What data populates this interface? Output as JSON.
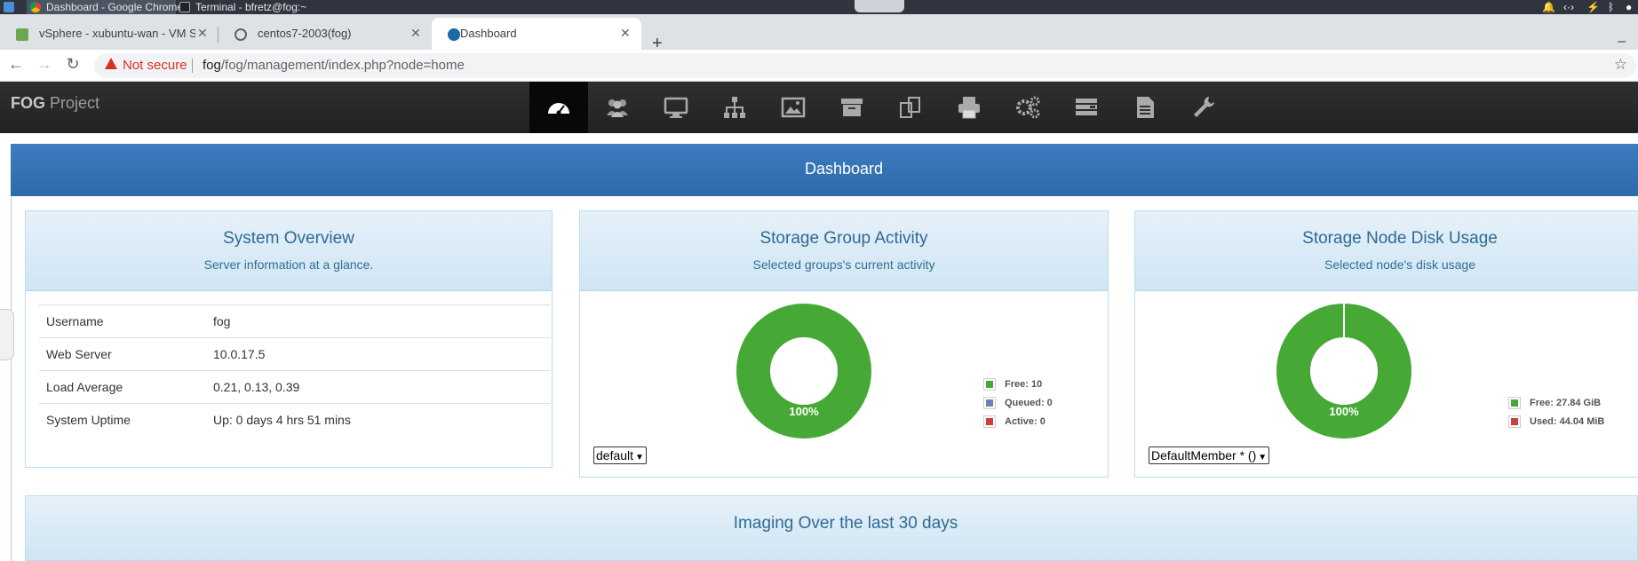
{
  "taskbar": {
    "tasks": [
      {
        "label": "Dashboard - Google Chrome",
        "active": true
      },
      {
        "label": "Terminal - bfretz@fog:~",
        "active": false
      }
    ]
  },
  "browser": {
    "tabs": [
      {
        "title": "vSphere - xubuntu-wan - VM SD",
        "icon": "vsphere-icon"
      },
      {
        "title": "centos7-2003(fog)",
        "icon": "globe-icon"
      },
      {
        "title": "Dashboard",
        "icon": "fog-favicon",
        "active": true
      }
    ],
    "security_label": "Not secure",
    "url_host": "fog",
    "url_path": "/fog/management/index.php?node=home"
  },
  "header": {
    "brand_bold": "FOG",
    "brand_rest": " Project",
    "nav": [
      {
        "icon": "dashboard-icon",
        "active": true
      },
      {
        "icon": "users-icon"
      },
      {
        "icon": "hosts-icon"
      },
      {
        "icon": "groups-icon"
      },
      {
        "icon": "images-icon"
      },
      {
        "icon": "storage-icon"
      },
      {
        "icon": "snapins-icon"
      },
      {
        "icon": "printers-icon"
      },
      {
        "icon": "service-icon"
      },
      {
        "icon": "tasks-icon"
      },
      {
        "icon": "reports-icon"
      },
      {
        "icon": "settings-icon"
      }
    ]
  },
  "dashboard": {
    "title": "Dashboard",
    "overview": {
      "title": "System Overview",
      "subtitle": "Server information at a glance.",
      "rows": [
        {
          "key": "Username",
          "value": "fog"
        },
        {
          "key": "Web Server",
          "value": "10.0.17.5"
        },
        {
          "key": "Load Average",
          "value": "0.21, 0.13, 0.39"
        },
        {
          "key": "System Uptime",
          "value": "Up: 0 days 4 hrs 51 mins"
        }
      ]
    },
    "group_activity": {
      "title": "Storage Group Activity",
      "subtitle": "Selected groups's current activity",
      "percent_label": "100%",
      "legend": [
        {
          "label": "Free: 10",
          "color": "#46a935"
        },
        {
          "label": "Queued: 0",
          "color": "#6d7fbf"
        },
        {
          "label": "Active: 0",
          "color": "#cb3f3f"
        }
      ],
      "select_value": "default"
    },
    "disk_usage": {
      "title": "Storage Node Disk Usage",
      "subtitle": "Selected node's disk usage",
      "percent_label": "100%",
      "legend": [
        {
          "label": "Free: 27.84 GiB",
          "color": "#46a935"
        },
        {
          "label": "Used: 44.04 MiB",
          "color": "#cb3f3f"
        }
      ],
      "select_value": "DefaultMember * ()"
    },
    "imaging_title": "Imaging Over the last 30 days"
  },
  "chart_data": [
    {
      "type": "pie",
      "title": "Storage Group Activity",
      "categories": [
        "Free",
        "Queued",
        "Active"
      ],
      "values": [
        10,
        0,
        0
      ]
    },
    {
      "type": "pie",
      "title": "Storage Node Disk Usage",
      "categories": [
        "Free",
        "Used"
      ],
      "values": [
        27.84,
        0.043
      ],
      "units": [
        "GiB",
        "GiB"
      ]
    }
  ]
}
